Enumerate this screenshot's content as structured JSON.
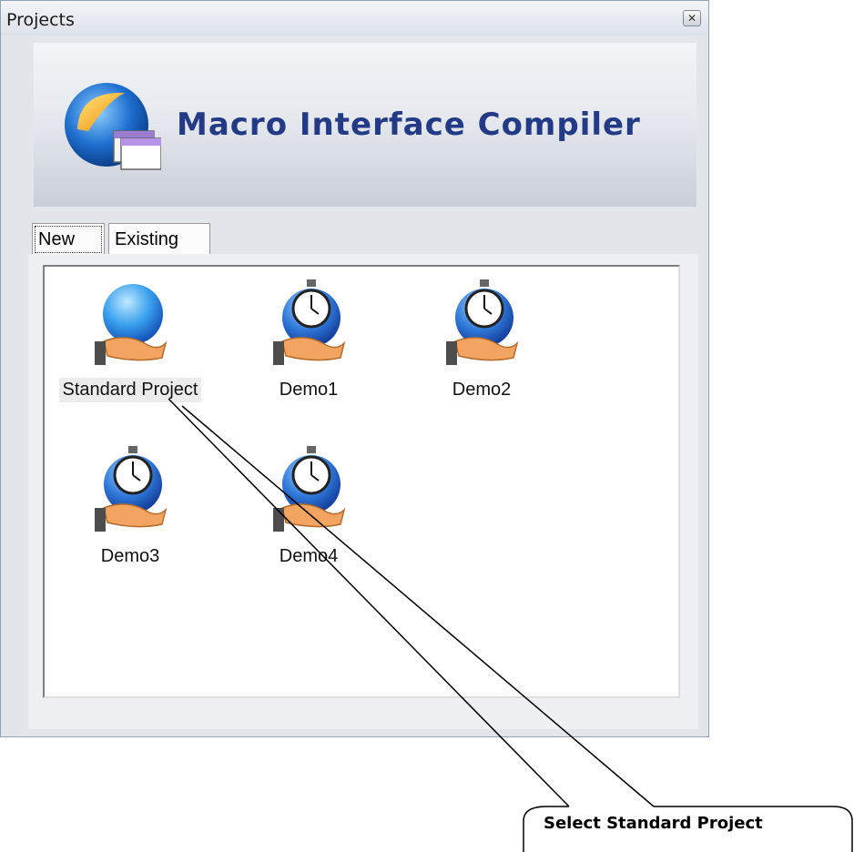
{
  "window": {
    "title": "Projects",
    "close_glyph": "✕",
    "banner_title": "Macro Interface Compiler"
  },
  "tabs": [
    {
      "label": "New",
      "active": true
    },
    {
      "label": "Existing",
      "active": false
    }
  ],
  "projects": [
    {
      "label": "Standard Project",
      "icon": "globe-hand-icon",
      "selected": true
    },
    {
      "label": "Demo1",
      "icon": "stopwatch-hand-icon"
    },
    {
      "label": "Demo2",
      "icon": "stopwatch-hand-icon"
    },
    {
      "label": "Demo3",
      "icon": "stopwatch-hand-icon"
    },
    {
      "label": "Demo4",
      "icon": "stopwatch-hand-icon"
    }
  ],
  "callout": {
    "text": "Select Standard Project"
  },
  "colors": {
    "banner_title": "#233b86",
    "window_bg": "#e2e5ea"
  }
}
